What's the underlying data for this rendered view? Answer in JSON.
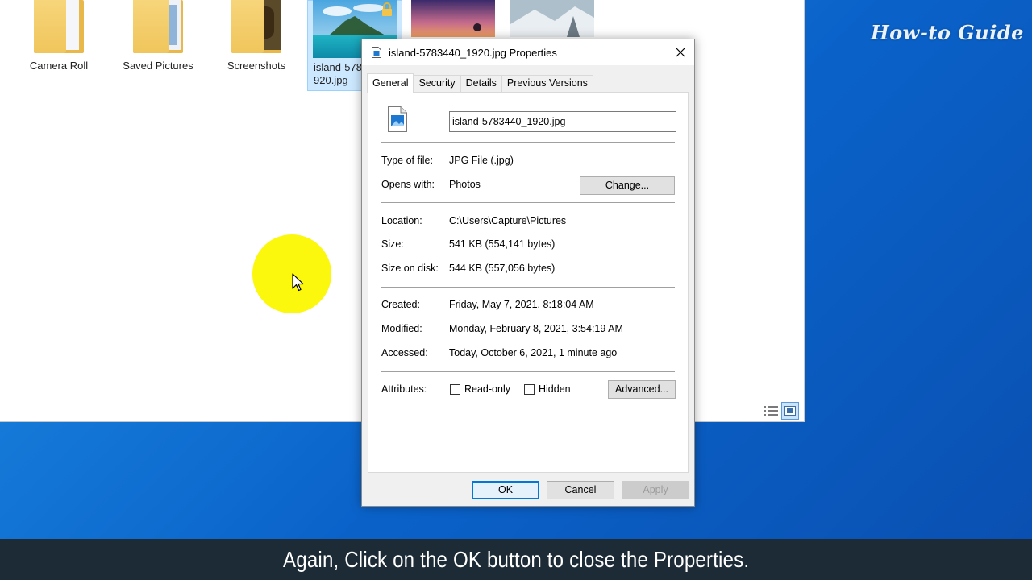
{
  "explorer": {
    "items": [
      {
        "name": "Camera Roll",
        "type": "folder"
      },
      {
        "name": "Saved Pictures",
        "type": "folder"
      },
      {
        "name": "Screenshots",
        "type": "folder"
      },
      {
        "name": "island-578\n920.jpg",
        "type": "image",
        "selected": true
      }
    ]
  },
  "watermark": "How-to Guide",
  "dialog": {
    "title": "island-5783440_1920.jpg Properties",
    "tabs": [
      {
        "label": "General",
        "active": true
      },
      {
        "label": "Security"
      },
      {
        "label": "Details"
      },
      {
        "label": "Previous Versions"
      }
    ],
    "filename": "island-5783440_1920.jpg",
    "type_label": "Type of file:",
    "type_value": "JPG File (.jpg)",
    "opens_label": "Opens with:",
    "opens_value": "Photos",
    "change_button": "Change...",
    "location_label": "Location:",
    "location_value": "C:\\Users\\Capture\\Pictures",
    "size_label": "Size:",
    "size_value": "541 KB (554,141 bytes)",
    "size_disk_label": "Size on disk:",
    "size_disk_value": "544 KB (557,056 bytes)",
    "created_label": "Created:",
    "created_value": "Friday, May 7, 2021, 8:18:04 AM",
    "modified_label": "Modified:",
    "modified_value": "Monday, February 8, 2021, 3:54:19 AM",
    "accessed_label": "Accessed:",
    "accessed_value": "Today, October 6, 2021, 1 minute ago",
    "attributes_label": "Attributes:",
    "readonly_label": "Read-only",
    "hidden_label": "Hidden",
    "advanced_button": "Advanced...",
    "ok_button": "OK",
    "cancel_button": "Cancel",
    "apply_button": "Apply"
  },
  "caption": "Again, Click on the OK button to close the Properties.",
  "colors": {
    "accent": "#0078d7",
    "desktop": "#0a62c9",
    "cursor_highlight": "#fbf700",
    "caption_bg": "#1c2b36"
  }
}
